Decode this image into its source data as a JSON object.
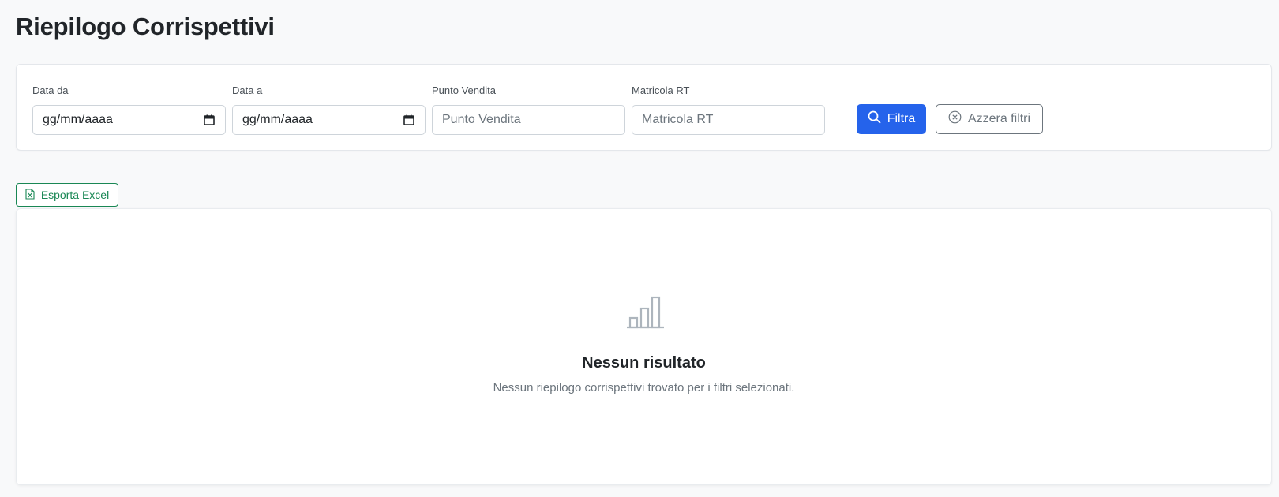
{
  "page": {
    "title": "Riepilogo Corrispettivi"
  },
  "filters": {
    "date_from": {
      "label": "Data da",
      "value": "gg/mm/aaaa",
      "icon": "calendar-icon"
    },
    "date_to": {
      "label": "Data a",
      "value": "gg/mm/aaaa",
      "icon": "calendar-icon"
    },
    "store": {
      "label": "Punto Vendita",
      "placeholder": "Punto Vendita"
    },
    "serial": {
      "label": "Matricola RT",
      "placeholder": "Matricola RT"
    },
    "filter_button": {
      "label": "Filtra",
      "icon": "search-icon"
    },
    "reset_button": {
      "label": "Azzera filtri",
      "icon": "x-circle-icon"
    }
  },
  "toolbar": {
    "export_label": "Esporta Excel",
    "export_icon": "excel-file-icon"
  },
  "empty_state": {
    "icon": "bar-chart-icon",
    "title": "Nessun risultato",
    "message": "Nessun riepilogo corrispettivi trovato per i filtri selezionati."
  },
  "colors": {
    "primary": "#2563eb",
    "success": "#198754",
    "muted": "#6c757d",
    "background": "#f8f9fa"
  }
}
